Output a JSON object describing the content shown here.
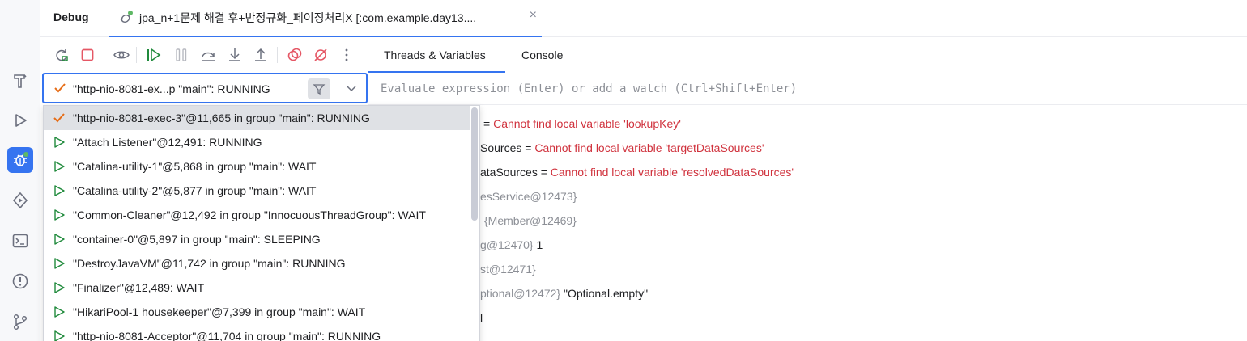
{
  "header": {
    "debug_label": "Debug",
    "session_tab_title": "jpa_n+1문제 해결 후+반정규화_페이징처리X [:com.example.day13....",
    "close_glyph": "×"
  },
  "leftbar": {
    "icons": [
      "build-icon",
      "run-icon",
      "debug-icon",
      "services-icon",
      "terminal-icon",
      "problems-icon",
      "git-icon"
    ]
  },
  "toolbar": {
    "tabs": {
      "threads_variables": "Threads & Variables",
      "console": "Console"
    }
  },
  "thread_selector": {
    "value": "\"http-nio-8081-ex...p \"main\": RUNNING"
  },
  "expression": {
    "placeholder": "Evaluate expression (Enter) or add a watch (Ctrl+Shift+Enter)"
  },
  "threads": [
    {
      "label": "\"http-nio-8081-exec-3\"@11,665 in group \"main\": RUNNING",
      "state": "current"
    },
    {
      "label": "\"Attach Listener\"@12,491: RUNNING",
      "state": "thread"
    },
    {
      "label": "\"Catalina-utility-1\"@5,868 in group \"main\": WAIT",
      "state": "thread"
    },
    {
      "label": "\"Catalina-utility-2\"@5,877 in group \"main\": WAIT",
      "state": "thread"
    },
    {
      "label": "\"Common-Cleaner\"@12,492 in group \"InnocuousThreadGroup\": WAIT",
      "state": "thread"
    },
    {
      "label": "\"container-0\"@5,897 in group \"main\": SLEEPING",
      "state": "thread"
    },
    {
      "label": "\"DestroyJavaVM\"@11,742 in group \"main\": RUNNING",
      "state": "thread"
    },
    {
      "label": "\"Finalizer\"@12,489: WAIT",
      "state": "thread"
    },
    {
      "label": "\"HikariPool-1 housekeeper\"@7,399 in group \"main\": WAIT",
      "state": "thread"
    },
    {
      "label": "\"http-nio-8081-Acceptor\"@11,704 in group \"main\": RUNNING",
      "state": "thread"
    }
  ],
  "variables": [
    {
      "prefix": "= ",
      "grey": "",
      "value": "Cannot find local variable 'lookupKey'",
      "value_kind": "error"
    },
    {
      "prefix": "Sources = ",
      "grey": "",
      "value": "Cannot find local variable 'targetDataSources'",
      "value_kind": "error"
    },
    {
      "prefix": "ataSources = ",
      "grey": "",
      "value": "Cannot find local variable 'resolvedDataSources'",
      "value_kind": "error"
    },
    {
      "prefix": "",
      "grey": "esService@12473}",
      "value": "",
      "value_kind": "plain"
    },
    {
      "prefix": "",
      "grey": "{Member@12469}",
      "value": "",
      "value_kind": "plain"
    },
    {
      "prefix": "",
      "grey": "g@12470}",
      "value": " 1",
      "value_kind": "plain"
    },
    {
      "prefix": "",
      "grey": "st@12471}",
      "value": "",
      "value_kind": "plain"
    },
    {
      "prefix": "",
      "grey": "ptional@12472}",
      "value": " \"Optional.empty\"",
      "value_kind": "plain"
    },
    {
      "prefix": "l",
      "grey": "",
      "value": "",
      "value_kind": "plain"
    }
  ],
  "colors": {
    "accent": "#3574f0",
    "error_text": "#d0323d",
    "run_green": "#208a3c",
    "stop_red": "#e55765",
    "check_orange": "#e66d17"
  }
}
